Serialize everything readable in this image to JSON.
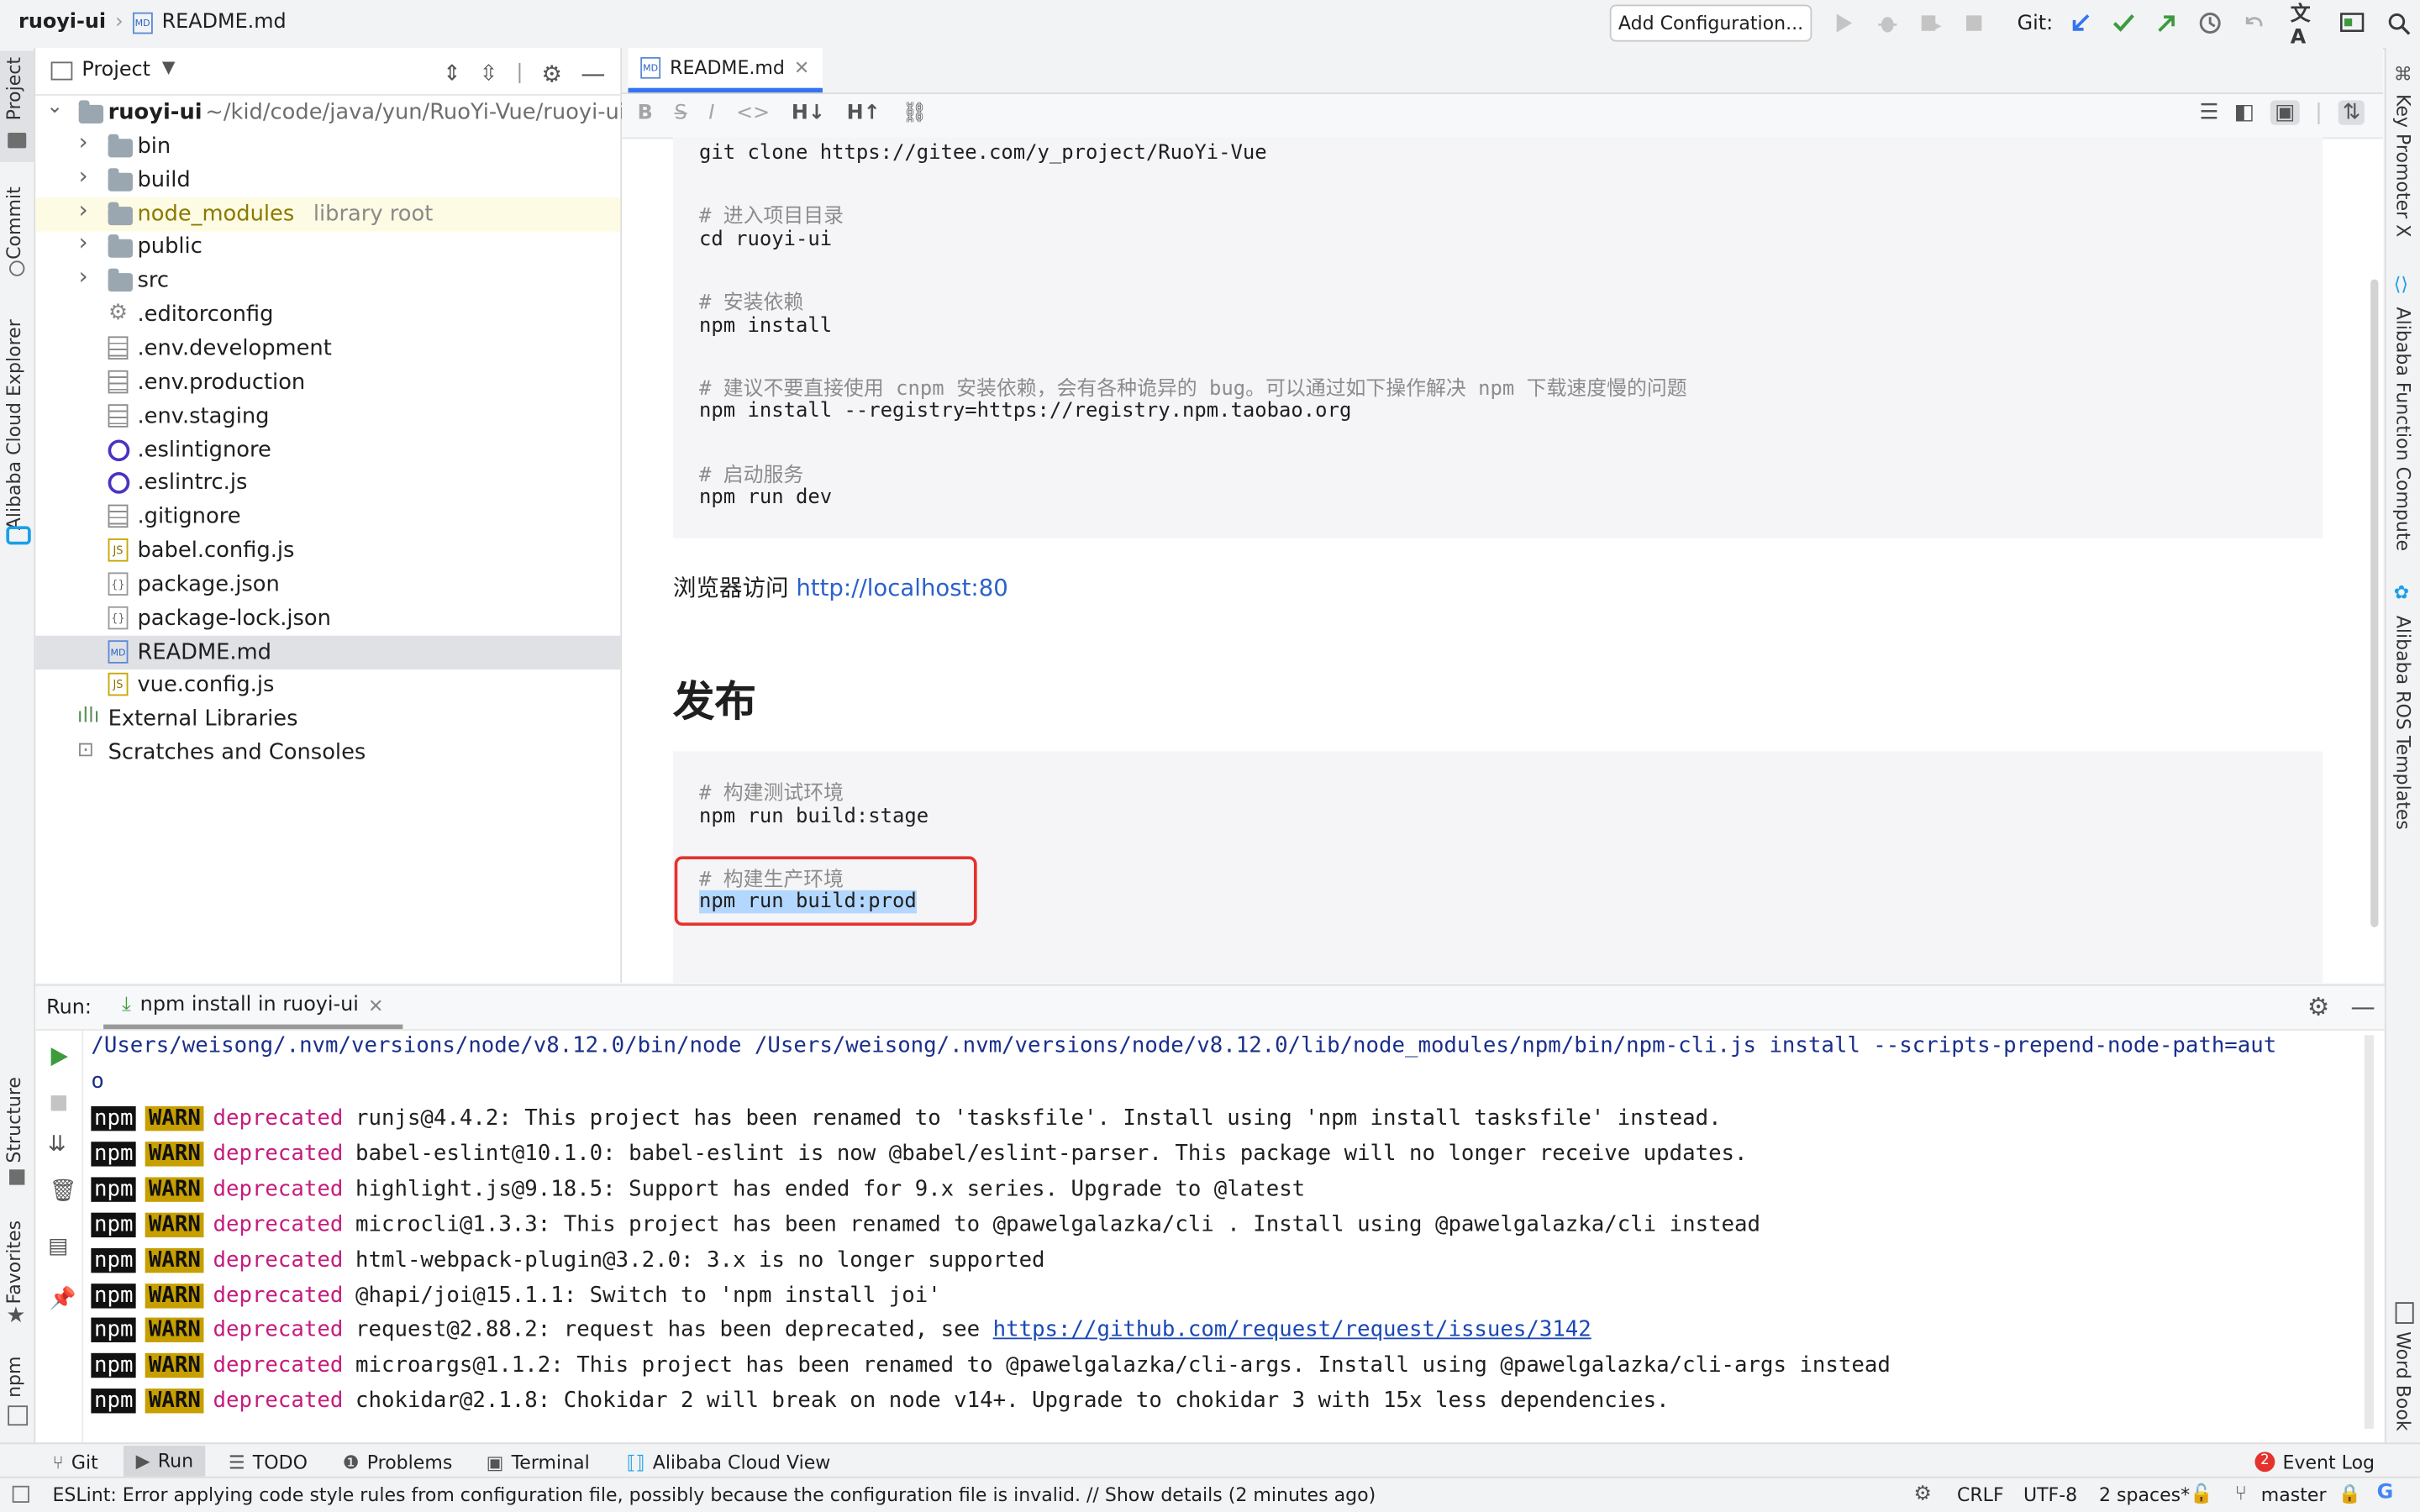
{
  "titlebar": {
    "project": "ruoyi-ui",
    "file": "README.md",
    "add_config": "Add Configuration...",
    "git_label": "Git:"
  },
  "left_strip": {
    "project": "Project",
    "commit": "Commit",
    "alibaba_explorer": "Alibaba Cloud Explorer",
    "structure": "Structure",
    "favorites": "Favorites",
    "npm": "npm"
  },
  "right_strip": {
    "key_promoter": "Key Promoter X",
    "function_compute": "Alibaba Function Compute",
    "ros_templates": "Alibaba ROS Templates",
    "word_book": "Word Book"
  },
  "project_panel": {
    "title": "Project",
    "root_name": "ruoyi-ui",
    "root_path": "~/kid/code/java/yun/RuoYi-Vue/ruoyi-ui",
    "items": [
      {
        "label": "bin",
        "type": "folder"
      },
      {
        "label": "build",
        "type": "folder"
      },
      {
        "label": "node_modules",
        "type": "folder",
        "suffix": "library root"
      },
      {
        "label": "public",
        "type": "folder"
      },
      {
        "label": "src",
        "type": "folder"
      },
      {
        "label": ".editorconfig",
        "type": "config"
      },
      {
        "label": ".env.development",
        "type": "file"
      },
      {
        "label": ".env.production",
        "type": "file"
      },
      {
        "label": ".env.staging",
        "type": "file"
      },
      {
        "label": ".eslintignore",
        "type": "eslint"
      },
      {
        "label": ".eslintrc.js",
        "type": "eslint"
      },
      {
        "label": ".gitignore",
        "type": "file"
      },
      {
        "label": "babel.config.js",
        "type": "js"
      },
      {
        "label": "package.json",
        "type": "json"
      },
      {
        "label": "package-lock.json",
        "type": "json"
      },
      {
        "label": "README.md",
        "type": "md"
      },
      {
        "label": "vue.config.js",
        "type": "js"
      }
    ],
    "external": "External Libraries",
    "scratches": "Scratches and Consoles"
  },
  "editor": {
    "tab": "README.md",
    "code1": [
      "git clone https://gitee.com/y_project/RuoYi-Vue",
      "",
      "# 进入项目目录",
      "cd ruoyi-ui",
      "",
      "# 安装依赖",
      "npm install",
      "",
      "# 建议不要直接使用 cnpm 安装依赖，会有各种诡异的 bug。可以通过如下操作解决 npm 下载速度慢的问题",
      "npm install --registry=https://registry.npm.taobao.org",
      "",
      "# 启动服务",
      "npm run dev"
    ],
    "visit_text": "浏览器访问 ",
    "visit_link": "http://localhost:80",
    "heading": "发布",
    "code2": [
      "# 构建测试环境",
      "npm run build:stage",
      "",
      "# 构建生产环境",
      "npm run build:prod"
    ]
  },
  "run_panel": {
    "label": "Run:",
    "tab": "npm install in ruoyi-ui",
    "command": "/Users/weisong/.nvm/versions/node/v8.12.0/bin/node /Users/weisong/.nvm/versions/node/v8.12.0/lib/node_modules/npm/bin/npm-cli.js install --scripts-prepend-node-path=aut",
    "command_wrap": "o",
    "npm": "npm",
    "warn": "WARN",
    "deprecated": "deprecated",
    "lines": [
      {
        "text": "runjs@4.4.2: This project has been renamed to 'tasksfile'. Install using 'npm install tasksfile' instead."
      },
      {
        "text": "babel-eslint@10.1.0: babel-eslint is now @babel/eslint-parser. This package will no longer receive updates."
      },
      {
        "text": "highlight.js@9.18.5: Support has ended for 9.x series. Upgrade to @latest"
      },
      {
        "text": "microcli@1.3.3: This project has been renamed to @pawelgalazka/cli . Install using @pawelgalazka/cli instead"
      },
      {
        "text": "html-webpack-plugin@3.2.0: 3.x is no longer supported"
      },
      {
        "text": "@hapi/joi@15.1.1: Switch to 'npm install joi'"
      },
      {
        "text": "request@2.88.2: request has been deprecated, see ",
        "link": "https://github.com/request/request/issues/3142"
      },
      {
        "text": "microargs@1.1.2: This project has been renamed to @pawelgalazka/cli-args. Install using @pawelgalazka/cli-args instead"
      },
      {
        "text": "chokidar@2.1.8: Chokidar 2 will break on node v14+. Upgrade to chokidar 3 with 15x less dependencies."
      }
    ]
  },
  "bottom_tabs": {
    "git": "Git",
    "run": "Run",
    "todo": "TODO",
    "problems": "Problems",
    "terminal": "Terminal",
    "alibaba": "Alibaba Cloud View",
    "event_count": "2",
    "event_log": "Event Log"
  },
  "status": {
    "message": "ESLint: Error applying code style rules from configuration file, possibly because the configuration file is invalid. // Show details (2 minutes ago)",
    "line_sep": "CRLF",
    "encoding": "UTF-8",
    "indent": "2 spaces*",
    "branch": "master"
  },
  "colors": {
    "accent": "#3574f0",
    "highlight_box": "#e5322d",
    "selection": "#b3d7ff"
  }
}
